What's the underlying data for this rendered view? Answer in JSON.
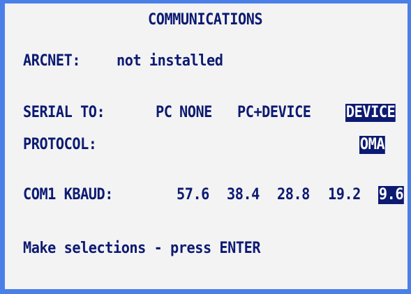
{
  "title": "COMMUNICATIONS",
  "arcnet": {
    "label": "ARCNET:",
    "value": "not installed"
  },
  "serial": {
    "label": "SERIAL TO:",
    "options": [
      "PC",
      "NONE",
      "PC+DEVICE",
      "DEVICE"
    ],
    "selected": "DEVICE"
  },
  "protocol": {
    "label": "PROTOCOL:",
    "options": [
      "OMA"
    ],
    "selected": "OMA"
  },
  "com1_kbaud": {
    "label": "COM1 KBAUD:",
    "options": [
      "57.6",
      "38.4",
      "28.8",
      "19.2",
      "9.6"
    ],
    "selected": "9.6"
  },
  "prompt": "Make selections - press ENTER",
  "colors": {
    "text": "#0c1a72",
    "background": "#f3f3f3",
    "border": "#4a7fe8",
    "selection_bg": "#0c1a72",
    "selection_fg": "#ffffff"
  }
}
